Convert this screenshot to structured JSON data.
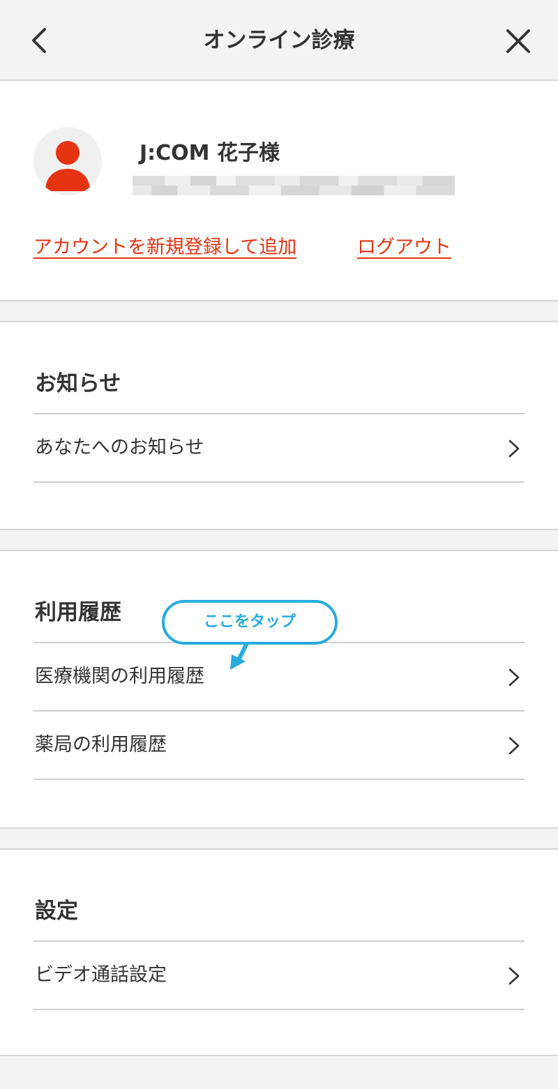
{
  "header": {
    "title": "オンライン診療",
    "back_icon": "chevron-left-icon",
    "close_icon": "close-icon"
  },
  "account": {
    "avatar_icon": "user-avatar-icon",
    "user_name": "J:COM 花子様",
    "register_link": "アカウントを新規登録して追加",
    "logout_link": "ログアウト"
  },
  "notifications": {
    "title": "お知らせ",
    "items": [
      {
        "label": "あなたへのお知らせ"
      }
    ]
  },
  "history": {
    "title": "利用履歴",
    "items": [
      {
        "label": "医療機関の利用履歴"
      },
      {
        "label": "薬局の利用履歴"
      }
    ]
  },
  "settings": {
    "title": "設定",
    "items": [
      {
        "label": "ビデオ通話設定"
      }
    ]
  },
  "callout": {
    "text": "ここをタップ"
  },
  "colors": {
    "accent": "#e63312",
    "callout": "#27abe0",
    "header_bg": "#f5f3f1"
  }
}
